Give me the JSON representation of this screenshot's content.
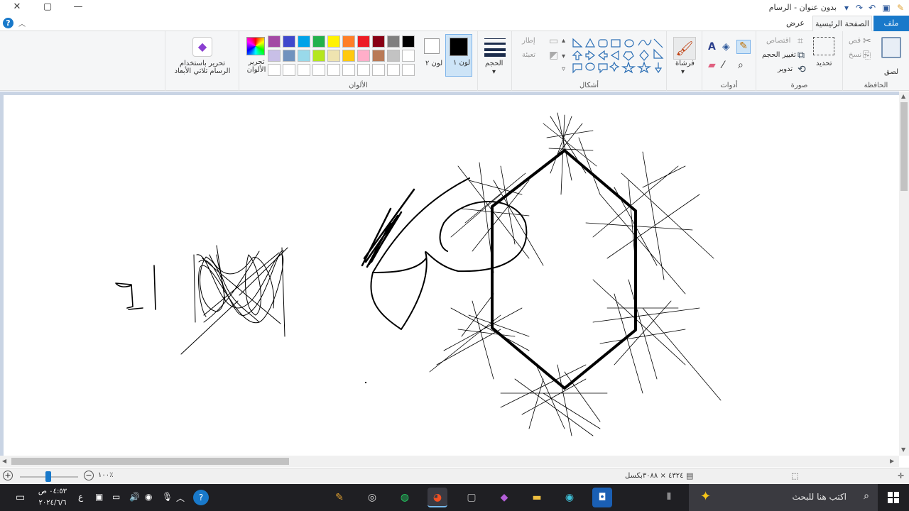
{
  "window": {
    "title": "بدون عنوان - الرسام",
    "minimize_glyph": "—",
    "restore_glyph": "▢",
    "close_glyph": "✕"
  },
  "tabs": {
    "file": "ملف",
    "home": "الصفحة الرئيسية",
    "view": "عرض"
  },
  "help_glyph": "?",
  "clipboard": {
    "paste": "لصق",
    "cut": "قص",
    "copy": "نسخ",
    "label": "الحافظة"
  },
  "image": {
    "select": "تحديد",
    "crop": "اقتصاص",
    "resize": "تغيير الحجم",
    "rotate": "تدوير",
    "label": "صورة"
  },
  "tools": {
    "label": "أدوات"
  },
  "brushes": {
    "label": "فرشاة"
  },
  "shapes": {
    "outline": "إطار",
    "fill": "تعبئة",
    "label": "أشكال"
  },
  "size": {
    "label": "الحجم"
  },
  "colors": {
    "color1_label": "لون ١",
    "color2_label": "لون ٢",
    "edit_colors": "تحرير الألوان",
    "label": "الألوان",
    "color1": "#000000",
    "color2": "#ffffff",
    "palette_row1": [
      "#000000",
      "#7f7f7f",
      "#880015",
      "#ed1c24",
      "#ff7f27",
      "#fff200",
      "#22b14c",
      "#00a2e8",
      "#3f48cc",
      "#a349a4"
    ],
    "palette_row2": [
      "#ffffff",
      "#c3c3c3",
      "#b97a57",
      "#ffaec9",
      "#ffc90e",
      "#efe4b0",
      "#b5e61d",
      "#99d9ea",
      "#7092be",
      "#c8bfe7"
    ]
  },
  "paint3d": {
    "label": "تحرير باستخدام الرسام ثلاثي الأبعاد"
  },
  "status": {
    "dimensions": "٤٣٢٤ × ٣٠٨٨بكسل",
    "zoom": "١٠٠٪"
  },
  "taskbar": {
    "search_placeholder": "اكتب هنا للبحث",
    "time": "٠٤:٥٣ ص",
    "date": "٢٠٢٤/٦/٦",
    "lang": "ع"
  }
}
